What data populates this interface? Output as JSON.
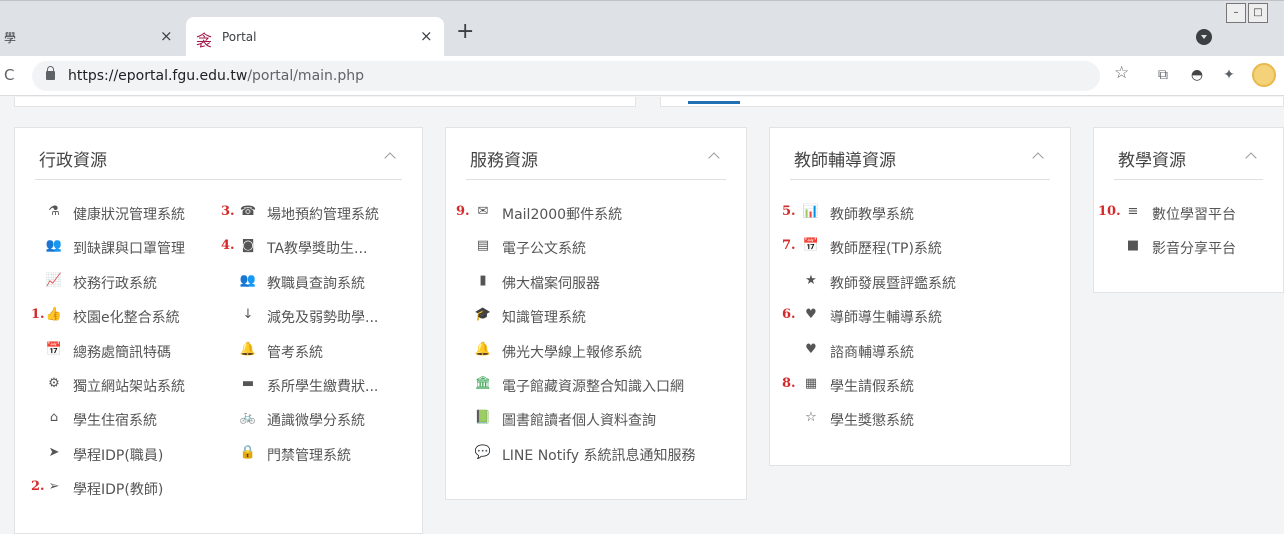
{
  "browser": {
    "tabs": [
      {
        "title": "學",
        "close": "×"
      },
      {
        "title": "Portal",
        "close": "×",
        "favicon": "衾"
      }
    ],
    "new_tab": "+",
    "reload": "C",
    "url_host": "https://eportal.fgu.edu.tw",
    "url_path": "/portal/main.php",
    "window_buttons": [
      "–",
      "□"
    ]
  },
  "panels": {
    "admin": {
      "title": "行政資源",
      "items": [
        {
          "num": "",
          "icon": "⚗",
          "label": "健康狀況管理系統"
        },
        {
          "num": "",
          "icon": "👥",
          "label": "到缺課與口罩管理"
        },
        {
          "num": "",
          "icon": "📈",
          "label": "校務行政系統"
        },
        {
          "num": "1.",
          "icon": "👍",
          "label": "校園e化整合系統"
        },
        {
          "num": "",
          "icon": "📅",
          "label": "總務處簡訊特碼"
        },
        {
          "num": "",
          "icon": "⚙",
          "label": "獨立網站架站系統"
        },
        {
          "num": "",
          "icon": "⌂",
          "label": "學生住宿系統"
        },
        {
          "num": "",
          "icon": "➤",
          "label": "學程IDP(職員)"
        },
        {
          "num": "2.",
          "icon": "➢",
          "label": "學程IDP(教師)"
        },
        {
          "num": "3.",
          "icon": "☎",
          "label": "場地預約管理系統"
        },
        {
          "num": "4.",
          "icon": "◙",
          "label": "TA教學獎助生..."
        },
        {
          "num": "",
          "icon": "👥",
          "label": "教職員查詢系統"
        },
        {
          "num": "",
          "icon": "↓",
          "label": "減免及弱勢助學..."
        },
        {
          "num": "",
          "icon": "🔔",
          "label": "管考系統"
        },
        {
          "num": "",
          "icon": "▬",
          "label": "系所學生繳費狀..."
        },
        {
          "num": "",
          "icon": "🚲",
          "label": "通識微學分系統"
        },
        {
          "num": "",
          "icon": "🔒",
          "label": "門禁管理系統"
        }
      ]
    },
    "service": {
      "title": "服務資源",
      "items": [
        {
          "num": "9.",
          "icon": "✉",
          "label": "Mail2000郵件系統"
        },
        {
          "num": "",
          "icon": "▤",
          "label": "電子公文系統"
        },
        {
          "num": "",
          "icon": "▮",
          "label": "佛大檔案伺服器"
        },
        {
          "num": "",
          "icon": "🎓",
          "label": "知識管理系統"
        },
        {
          "num": "",
          "icon": "🔔",
          "label": "佛光大學線上報修系統"
        },
        {
          "num": "",
          "icon": "🏛",
          "label": "電子館藏資源整合知識入口網"
        },
        {
          "num": "",
          "icon": "📗",
          "label": "圖書館讀者個人資料查詢"
        },
        {
          "num": "",
          "icon": "💬",
          "label": "LINE Notify 系統訊息通知服務"
        }
      ]
    },
    "teacher": {
      "title": "教師輔導資源",
      "items": [
        {
          "num": "5.",
          "icon": "📊",
          "label": "教師教學系統"
        },
        {
          "num": "7.",
          "icon": "📅",
          "label": "教師歷程(TP)系統"
        },
        {
          "num": "",
          "icon": "★",
          "label": "教師發展暨評鑑系統"
        },
        {
          "num": "6.",
          "icon": "♥",
          "label": "導師導生輔導系統"
        },
        {
          "num": "",
          "icon": "♥",
          "label": "諮商輔導系統"
        },
        {
          "num": "8.",
          "icon": "▦",
          "label": "學生請假系統"
        },
        {
          "num": "",
          "icon": "☆",
          "label": "學生獎懲系統"
        }
      ]
    },
    "teaching": {
      "title": "教學資源",
      "items": [
        {
          "num": "10.",
          "icon": "≡",
          "label": "數位學習平台"
        },
        {
          "num": "",
          "icon": "■",
          "label": "影音分享平台"
        }
      ]
    }
  }
}
